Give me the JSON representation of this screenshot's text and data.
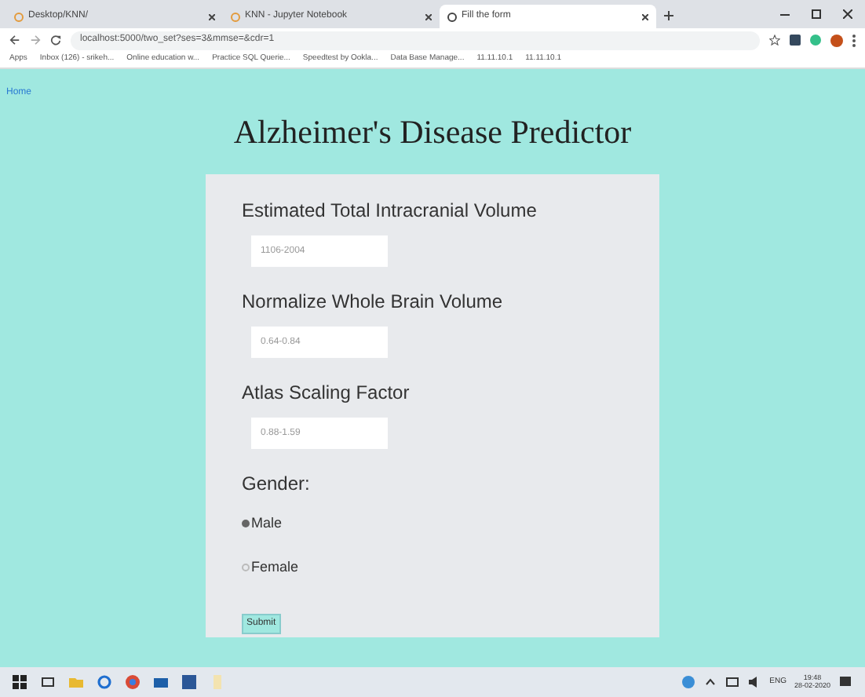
{
  "browser": {
    "tabs": [
      {
        "title": "Desktop/KNN/",
        "selected": false
      },
      {
        "title": "KNN - Jupyter Notebook",
        "selected": false
      },
      {
        "title": "Fill the form",
        "selected": true
      }
    ],
    "url": "localhost:5000/two_set?ses=3&mmse=&cdr=1",
    "bookmarks": [
      {
        "title": "Apps"
      },
      {
        "title": "Inbox (126) - srikeh..."
      },
      {
        "title": "Online education w..."
      },
      {
        "title": "Practice SQL Querie..."
      },
      {
        "title": "Speedtest by Ookla..."
      },
      {
        "title": "Data Base Manage..."
      },
      {
        "title": "11.11.10.1"
      },
      {
        "title": "11.11.10.1"
      }
    ]
  },
  "page": {
    "home_link": "Home",
    "title": "Alzheimer's Disease Predictor",
    "fields": [
      {
        "label": "Estimated Total Intracranial Volume",
        "placeholder": "1106-2004"
      },
      {
        "label": "Normalize Whole Brain Volume",
        "placeholder": "0.64-0.84"
      },
      {
        "label": "Atlas Scaling Factor",
        "placeholder": "0.88-1.59"
      }
    ],
    "gender": {
      "label": "Gender:",
      "options": [
        {
          "label": "Male",
          "selected": true
        },
        {
          "label": "Female",
          "selected": false
        }
      ]
    },
    "submit": "Submit"
  },
  "taskbar": {
    "language": "ENG",
    "time": "19:48",
    "date": "28-02-2020"
  }
}
